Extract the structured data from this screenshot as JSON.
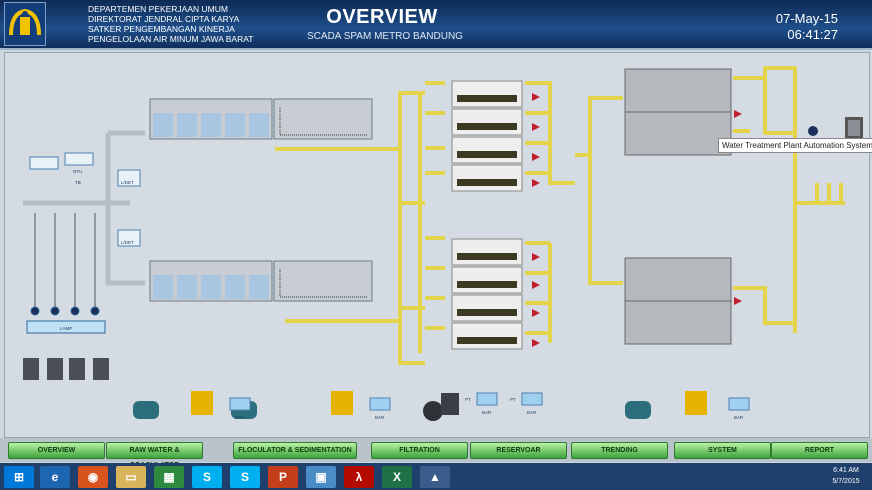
{
  "header": {
    "org_lines": [
      "DEPARTEMEN PEKERJAAN UMUM",
      "DIREKTORAT JENDRAL CIPTA KARYA",
      "SATKER PENGEMBANGAN KINERJA",
      "PENGELOLAAN AIR MINUM JAWA BARAT"
    ],
    "title": "OVERVIEW",
    "subtitle": "SCADA SPAM METRO BANDUNG",
    "date": "07-May-15",
    "time": "06:41:27"
  },
  "instruments": {
    "ntu": "NTU",
    "tb": "TB",
    "pt": "PT",
    "bar": "BAR",
    "l_det": "L/DET",
    "lamp": "LAMP"
  },
  "tooltip": "Water Treatment Plant Automation System",
  "nav": [
    "OVERVIEW",
    "RAW WATER & COAGULATOR",
    "FLOCULATOR & SEDIMENTATION",
    "FILTRATION",
    "RESERVOAR",
    "TRENDING",
    "SYSTEM",
    "REPORT"
  ],
  "taskbar": {
    "icons": [
      "windows-start-icon",
      "internet-explorer-icon",
      "firefox-icon",
      "file-explorer-icon",
      "store-icon",
      "skype-icon",
      "skype-alt-icon",
      "powerpoint-icon",
      "remote-desktop-icon",
      "acrobat-icon",
      "excel-icon",
      "scada-app-icon"
    ],
    "glyphs": [
      "⊞",
      "e",
      "◉",
      "▭",
      "▦",
      "S",
      "S",
      "P",
      "▣",
      "λ",
      "X",
      "▲"
    ],
    "clock_time": "6:41 AM",
    "clock_date": "5/7/2015"
  },
  "colors": {
    "pipe": "#e6d84a",
    "header_bg": "#173d70",
    "button": "#58b84f",
    "alarm_valve": "#c0202e"
  }
}
